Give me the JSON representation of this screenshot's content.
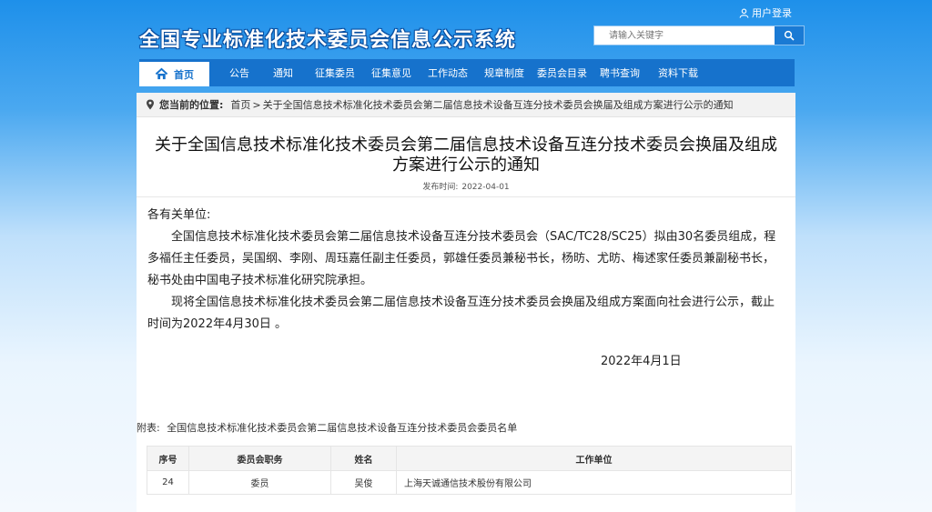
{
  "header": {
    "site_title": "全国专业标准化技术委员会信息公示系统",
    "login_label": "用户登录",
    "search_placeholder": "请输入关键字"
  },
  "nav": {
    "home_label": "首页",
    "items": [
      "公告",
      "通知",
      "征集委员",
      "征集意见",
      "工作动态",
      "规章制度",
      "委员会目录",
      "聘书查询",
      "资料下载"
    ]
  },
  "breadcrumb": {
    "label": "您当前的位置:",
    "home": "首页",
    "separator": ">",
    "current": "关于全国信息技术标准化技术委员会第二届信息技术设备互连分技术委员会换届及组成方案进行公示的通知"
  },
  "article": {
    "title": "关于全国信息技术标准化技术委员会第二届信息技术设备互连分技术委员会换届及组成方案进行公示的通知",
    "publish_label": "发布时间:",
    "publish_date": "2022-04-01",
    "salutation": "各有关单位:",
    "paragraph1": "全国信息技术标准化技术委员会第二届信息技术设备互连分技术委员会（SAC/TC28/SC25）拟由30名委员组成，程多福任主任委员，吴国纲、李刚、周珏嘉任副主任委员，郭雄任委员兼秘书长，杨昉、尤昉、梅述家任委员兼副秘书长，秘书处由中国电子技术标准化研究院承担。",
    "paragraph2": "现将全国信息技术标准化技术委员会第二届信息技术设备互连分技术委员会换届及组成方案面向社会进行公示，截止时间为2022年4月30日 。",
    "sign_date": "2022年4月1日"
  },
  "attachment": {
    "label": "附表:",
    "title": "全国信息技术标准化技术委员会第二届信息技术设备互连分技术委员会委员名单"
  },
  "table": {
    "headers": [
      "序号",
      "委员会职务",
      "姓名",
      "工作单位"
    ],
    "rows": [
      [
        "24",
        "委员",
        "吴俊",
        "上海天诚通信技术股份有限公司"
      ]
    ]
  }
}
